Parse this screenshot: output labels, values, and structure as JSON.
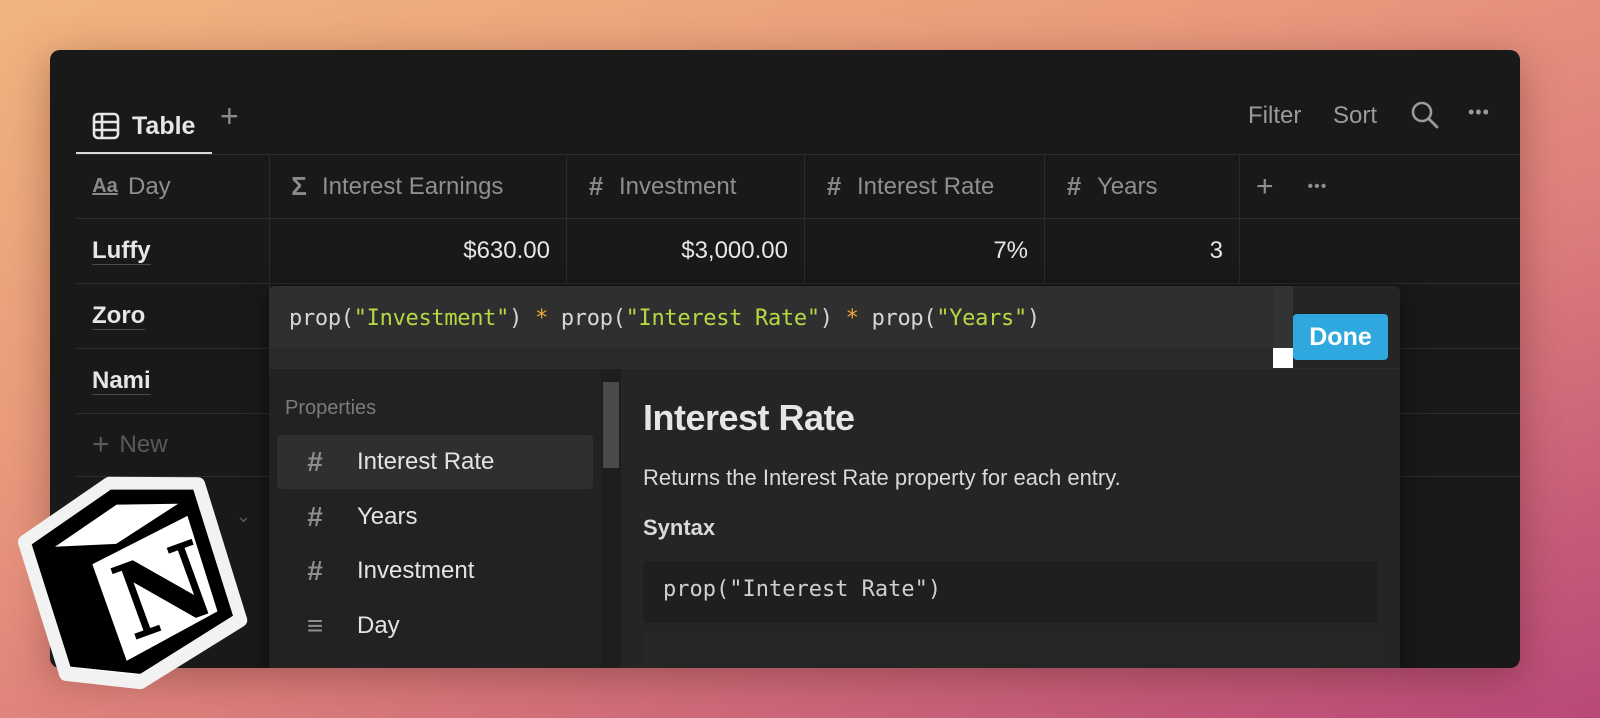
{
  "toolbar": {
    "tab_label": "Table",
    "tab_icon": "table-icon",
    "add_view": "+",
    "filter": "Filter",
    "sort": "Sort",
    "search_icon": "search-icon",
    "more": "•••"
  },
  "table": {
    "columns": [
      {
        "label": "Day",
        "icon": "Aa",
        "icon_name": "title-icon"
      },
      {
        "label": "Interest Earnings",
        "icon": "Σ",
        "icon_name": "formula-icon"
      },
      {
        "label": "Investment",
        "icon": "#",
        "icon_name": "number-icon"
      },
      {
        "label": "Interest Rate",
        "icon": "#",
        "icon_name": "number-icon"
      },
      {
        "label": "Years",
        "icon": "#",
        "icon_name": "number-icon"
      }
    ],
    "add_column": "+",
    "column_more": "•••",
    "rows": [
      {
        "day": "Luffy",
        "earnings": "$630.00",
        "investment": "$3,000.00",
        "rate": "7%",
        "years": "3"
      },
      {
        "day": "Zoro"
      },
      {
        "day": "Nami"
      }
    ],
    "new_row": "New",
    "new_icon": "+"
  },
  "formula": {
    "parts": [
      {
        "t": "prop(",
        "k": "plain"
      },
      {
        "t": "\"Investment\"",
        "k": "str"
      },
      {
        "t": ") ",
        "k": "plain"
      },
      {
        "t": "*",
        "k": "op"
      },
      {
        "t": " prop(",
        "k": "plain"
      },
      {
        "t": "\"Interest Rate\"",
        "k": "str"
      },
      {
        "t": ") ",
        "k": "plain"
      },
      {
        "t": "*",
        "k": "op"
      },
      {
        "t": " prop(",
        "k": "plain"
      },
      {
        "t": "\"Years\"",
        "k": "str"
      },
      {
        "t": ")",
        "k": "plain"
      }
    ],
    "done": "Done",
    "colors": {
      "string": "#b6d943",
      "operator": "#f0a93b",
      "done_bg": "#2ea8df"
    }
  },
  "properties": {
    "title": "Properties",
    "items": [
      {
        "label": "Interest Rate",
        "icon": "#",
        "active": true
      },
      {
        "label": "Years",
        "icon": "#"
      },
      {
        "label": "Investment",
        "icon": "#"
      },
      {
        "label": "Day",
        "icon": "≡"
      }
    ]
  },
  "doc": {
    "title": "Interest Rate",
    "description": "Returns the Interest Rate property for each entry.",
    "syntax_label": "Syntax",
    "syntax_code": "prop(\"Interest Rate\")"
  },
  "logo": {
    "letter": "N",
    "name": "notion-logo"
  }
}
